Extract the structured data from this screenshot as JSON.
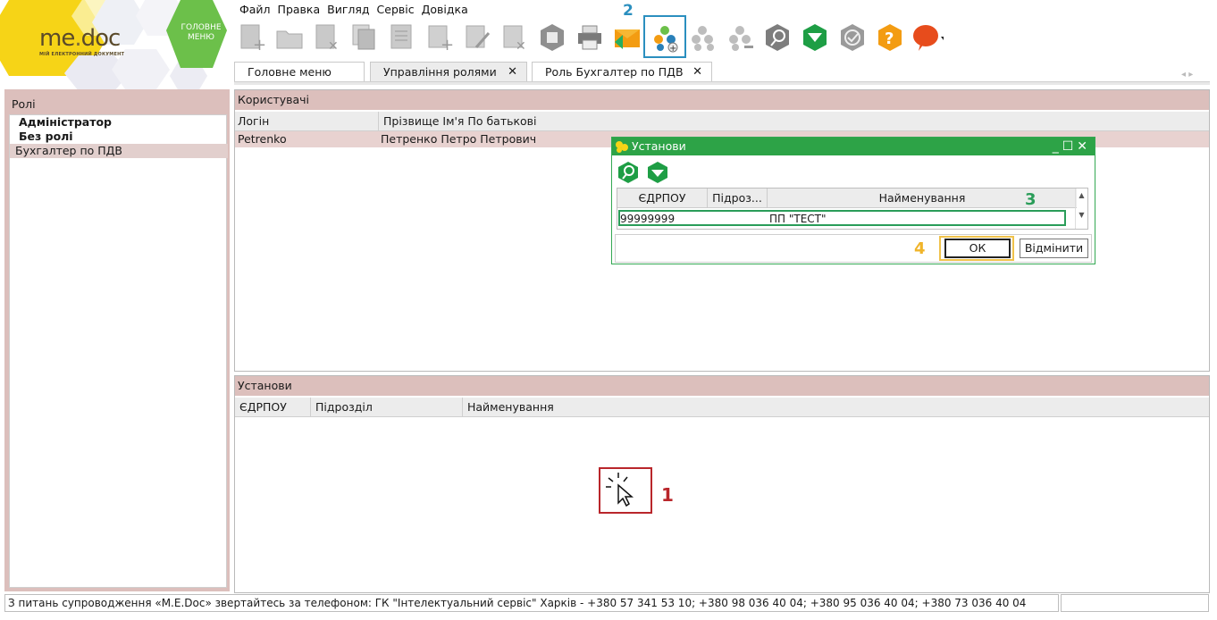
{
  "logo": {
    "brand_me": "me",
    "brand_doc": "doc",
    "brand_sub": "МІЙ ЕЛЕКТРОННИЙ ДОКУМЕНТ",
    "main_menu_line1": "ГОЛОВНЕ",
    "main_menu_line2": "МЕНЮ"
  },
  "menu": [
    "Файл",
    "Правка",
    "Вигляд",
    "Сервіс",
    "Довідка"
  ],
  "toolbar": {
    "icons": [
      "add-doc-icon",
      "open-doc-icon",
      "delete-doc-icon",
      "copy-doc-icon",
      "edit-doc-icon",
      "add-row-icon",
      "edit-row-icon",
      "delete-row-icon",
      "archive-icon",
      "print-icon",
      "send-icon",
      "add-organization-icon",
      "add-group-icon",
      "remove-group-icon",
      "find-icon",
      "filter-icon",
      "check-icon",
      "help-icon",
      "chat-icon"
    ],
    "annotation": "2"
  },
  "tabs": [
    {
      "label": "Головне меню",
      "closable": false
    },
    {
      "label": "Управління ролями",
      "closable": true
    },
    {
      "label": "Роль Бухгалтер по ПДВ",
      "closable": true
    }
  ],
  "tab_close": "✕",
  "roles_panel": {
    "title": "Ролі",
    "items": [
      {
        "label": "Адміністратор"
      },
      {
        "label": "Без ролі"
      },
      {
        "label": "Бухгалтер по ПДВ"
      }
    ]
  },
  "users_panel": {
    "title": "Користувачі",
    "columns": [
      "Логін",
      "Прізвище Ім'я По батькові"
    ],
    "rows": [
      {
        "login": "Petrenko",
        "name": "Петренко Петро Петрович"
      }
    ]
  },
  "orgs_panel": {
    "title": "Установи",
    "columns": [
      "ЄДРПОУ",
      "Підрозділ",
      "Найменування"
    ]
  },
  "annotations": {
    "label1": "1",
    "label3": "3",
    "label4": "4"
  },
  "dialog": {
    "title": "Установи",
    "columns": [
      "ЄДРПОУ",
      "Підроз...",
      "Найменування"
    ],
    "row": {
      "edrpou": "99999999",
      "unit": "",
      "name": "ПП \"ТЕСТ\""
    },
    "ok_label": "ОК",
    "cancel_label": "Відмінити"
  },
  "status_text": "З питань супроводження «M.E.Doc» звертайтесь за телефоном: ГК \"Інтелектуальний сервіс\" Харків - +380 57 341 53 10; +380 98 036 40 04; +380 95 036 40 04; +380 73 036 40 04",
  "colors": {
    "accent_green": "#2da347",
    "panel_header": "#dcbfbc",
    "annotation_red": "#b9262b",
    "annotation_blue": "#2b8fbf",
    "annotation_yellow": "#f0b429",
    "logo_yellow": "#f6d417",
    "logo_green": "#6cc04a"
  }
}
